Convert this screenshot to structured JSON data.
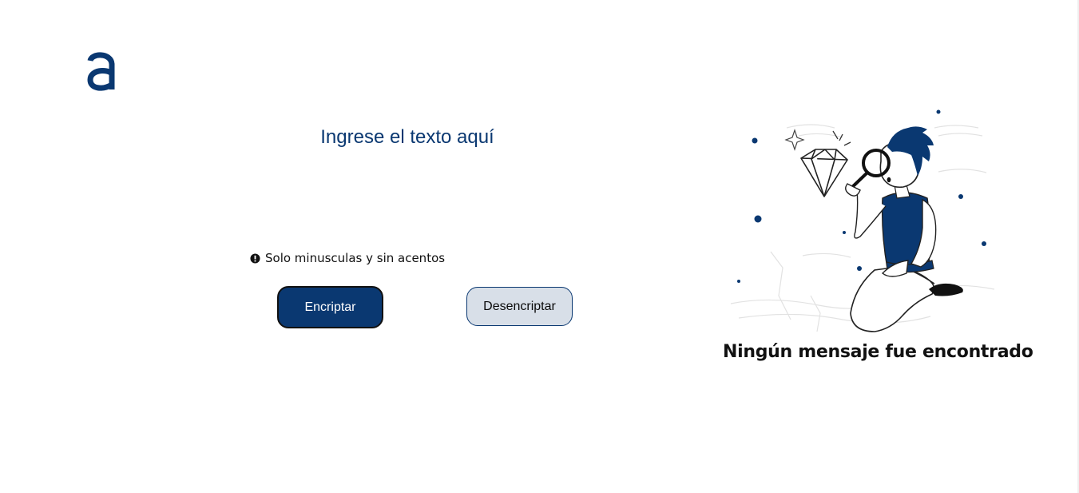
{
  "brand": {
    "logo_icon": "alura-a-logo-icon",
    "color": "#0a3871"
  },
  "input": {
    "placeholder": "Ingrese el texto aquí",
    "value": ""
  },
  "hint": {
    "icon": "exclamation-circle-icon",
    "text": "Solo minusculas y sin acentos"
  },
  "buttons": {
    "encrypt_label": "Encriptar",
    "decrypt_label": "Desencriptar"
  },
  "output": {
    "illustration": "boy-magnifying-glass-diamond-illustration",
    "empty_title": "Ningún mensaje fue encontrado"
  },
  "colors": {
    "primary": "#0a3871",
    "secondary_button_bg": "#d8dfe8",
    "text_dark": "#111111"
  }
}
